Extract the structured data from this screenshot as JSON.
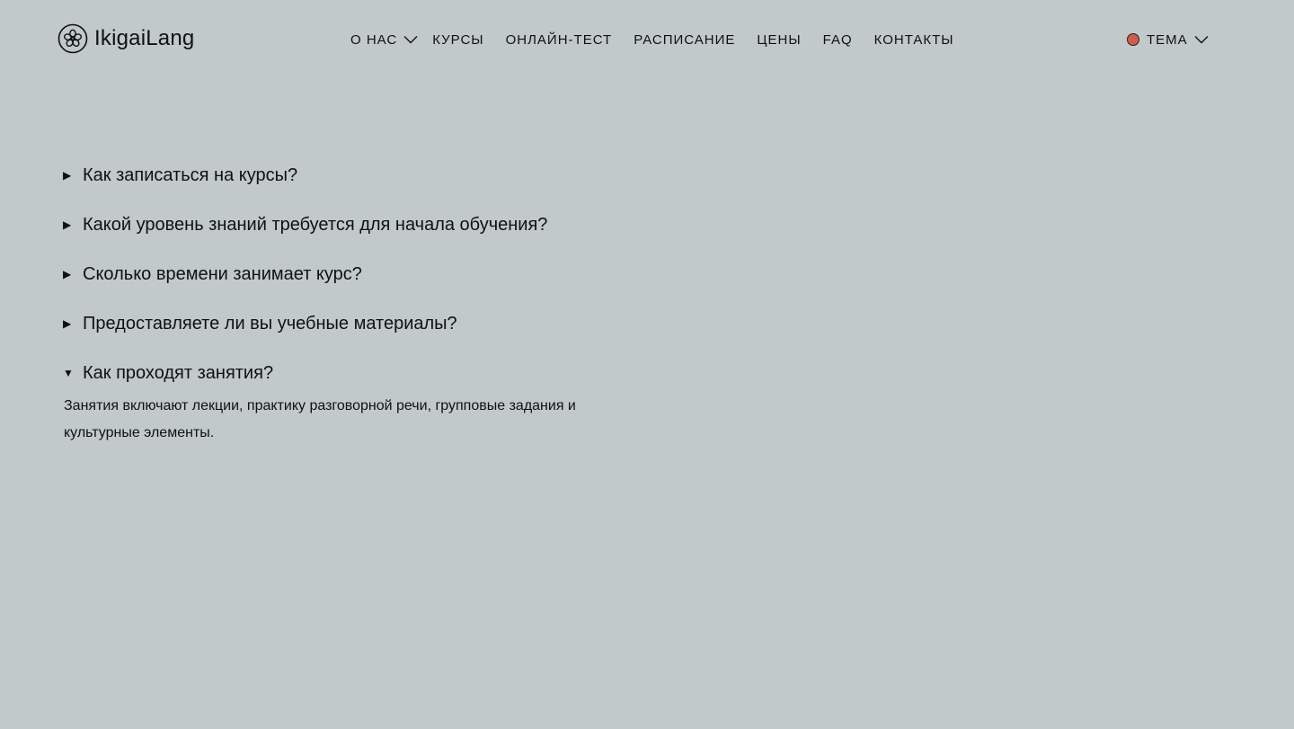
{
  "brand": {
    "name": "IkigaiLang"
  },
  "nav": {
    "items": [
      {
        "label": "О НАС",
        "has_dropdown": true
      },
      {
        "label": "КУРСЫ"
      },
      {
        "label": "ОНЛАЙН-ТЕСТ"
      },
      {
        "label": "РАСПИСАНИЕ"
      },
      {
        "label": "ЦЕНЫ"
      },
      {
        "label": "FAQ"
      },
      {
        "label": "КОНТАКТЫ"
      }
    ]
  },
  "theme": {
    "label": "ТЕМА",
    "color": "#d25c4c"
  },
  "faq": {
    "items": [
      {
        "question": "Как записаться на курсы?",
        "open": false
      },
      {
        "question": "Какой уровень знаний требуется для начала обучения?",
        "open": false
      },
      {
        "question": "Сколько времени занимает курс?",
        "open": false
      },
      {
        "question": "Предоставляете ли вы учебные материалы?",
        "open": false
      },
      {
        "question": "Как проходят занятия?",
        "open": true,
        "answer": "Занятия включают лекции, практику разговорной речи, групповые задания и культурные элементы."
      }
    ]
  },
  "colors": {
    "background": "#c1c9ca",
    "text": "#111111",
    "accent": "#d25c4c"
  },
  "icons": {
    "logo": "flower-logo-icon",
    "dropdown": "chevron-down-icon",
    "collapsed": "triangle-right-icon",
    "expanded": "triangle-down-icon"
  }
}
